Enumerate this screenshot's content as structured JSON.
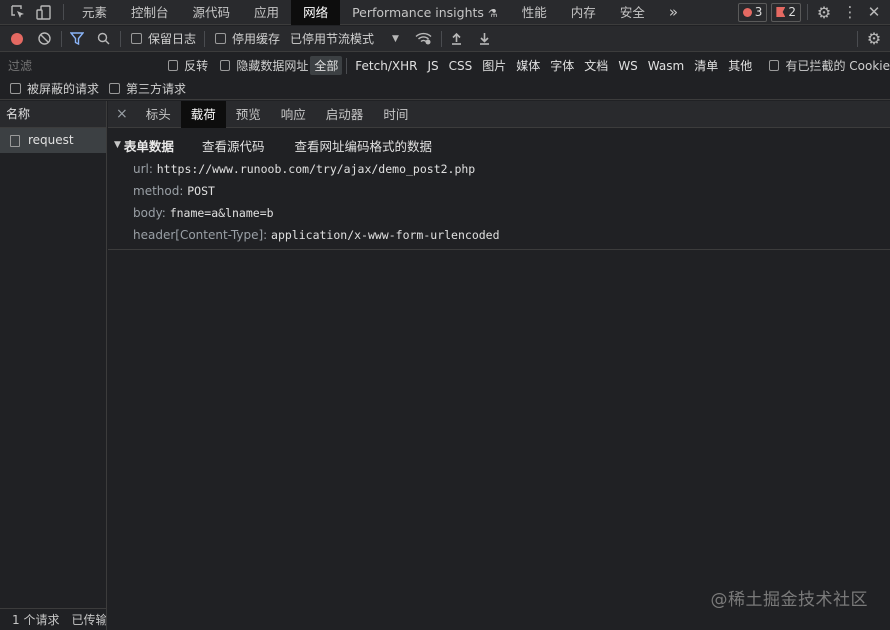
{
  "topbar": {
    "tabs": [
      "元素",
      "控制台",
      "源代码",
      "应用",
      "网络",
      "Performance insights",
      "性能",
      "内存",
      "安全"
    ],
    "more": "»",
    "errors_count": "3",
    "issues_count": "2"
  },
  "toolbar": {
    "preserve_log": "保留日志",
    "disable_cache": "停用缓存",
    "throttle_value": "已停用节流模式"
  },
  "filter": {
    "placeholder": "过滤",
    "invert": "反转",
    "hide_data_urls": "隐藏数据网址",
    "types": [
      "全部",
      "Fetch/XHR",
      "JS",
      "CSS",
      "图片",
      "媒体",
      "字体",
      "文档",
      "WS",
      "Wasm",
      "清单",
      "其他"
    ],
    "blocked_cookies": "有已拦截的 Cookie",
    "blocked_requests": "被屏蔽的请求",
    "third_party": "第三方请求"
  },
  "left": {
    "header": "名称",
    "request_name": "request",
    "footer_count": "1 个请求",
    "footer_transferred": "已传输"
  },
  "detail": {
    "close": "×",
    "tabs": [
      "标头",
      "载荷",
      "预览",
      "响应",
      "启动器",
      "时间"
    ],
    "payload_title": "表单数据",
    "view_source": "查看源代码",
    "view_url_encoded": "查看网址编码格式的数据",
    "fields": [
      {
        "key": "url:",
        "value": "https://www.runoob.com/try/ajax/demo_post2.php"
      },
      {
        "key": "method:",
        "value": "POST"
      },
      {
        "key": "body:",
        "value": "fname=a&lname=b"
      },
      {
        "key": "header[Content-Type]:",
        "value": "application/x-www-form-urlencoded"
      }
    ]
  },
  "watermark": "@稀土掘金技术社区",
  "colors": {
    "accent": "#8ab4f8",
    "record": "#e46962"
  }
}
